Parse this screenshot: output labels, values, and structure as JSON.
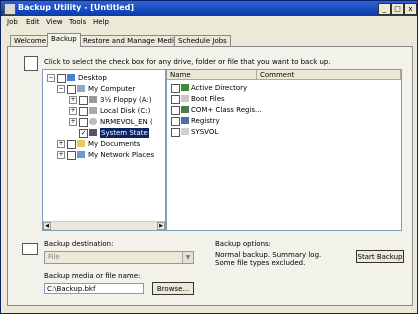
{
  "window": {
    "title": "Backup Utility - [Untitled]",
    "min": "_",
    "max": "□",
    "close": "x"
  },
  "menubar": [
    "Job",
    "Edit",
    "View",
    "Tools",
    "Help"
  ],
  "tabs": [
    "Welcome",
    "Backup",
    "Restore and Manage Media",
    "Schedule Jobs"
  ],
  "hint": "Click to select the check box for any drive, folder or file that you want to back up.",
  "tree": {
    "desktop": "Desktop",
    "my_computer": "My Computer",
    "floppy": "3½ Floppy (A:)",
    "local_disk": "Local Disk (C:)",
    "cdrom": "NRMEVOL_EN (",
    "system_state": "System State",
    "my_documents": "My Documents",
    "network": "My Network Places"
  },
  "list": {
    "col_name": "Name",
    "col_comment": "Comment",
    "items": [
      "Active Directory",
      "Boot Files",
      "COM+ Class Regis...",
      "Registry",
      "SYSVOL"
    ]
  },
  "destination": {
    "label": "Backup destination:",
    "value": "File"
  },
  "options": {
    "label": "Backup options:",
    "line1": "Normal backup.  Summary log.",
    "line2": "Some file types excluded."
  },
  "media": {
    "label": "Backup media or file name:",
    "value": "C:\\Backup.bkf"
  },
  "buttons": {
    "browse": "Browse...",
    "start": "Start Backup"
  }
}
